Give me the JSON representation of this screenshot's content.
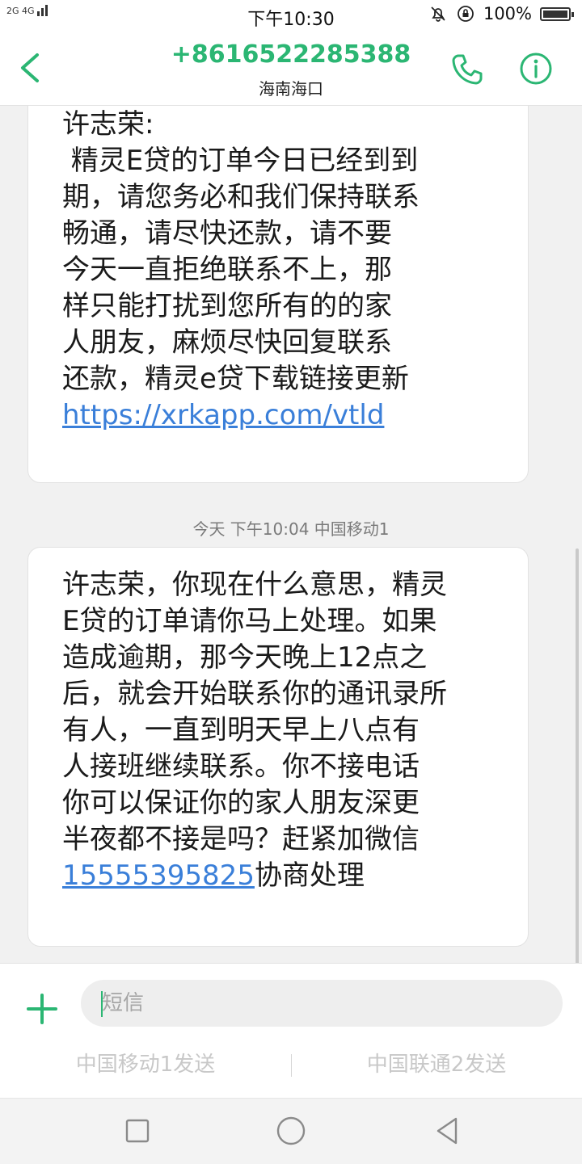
{
  "status_bar": {
    "left_indicators": "2G  4G",
    "time": "下午10:30",
    "battery_text": "100%",
    "battery_level": 1.0
  },
  "header": {
    "title": "+8616522285388",
    "subtitle": "海南海口",
    "icons": [
      "back-icon",
      "phone-icon",
      "info-icon"
    ],
    "accent_color": "#2bb673"
  },
  "messages": [
    {
      "lines": [
        "许志荣:",
        " 精灵E贷的订单今日已经到到",
        "期，请您务必和我们保持联系",
        "畅通，请尽快还款，请不要",
        "今天一直拒绝联系不上，那",
        "样只能打扰到您所有的的家",
        "人朋友，麻烦尽快回复联系",
        "还款，精灵e贷下载链接更新"
      ],
      "link": "https://xrkapp.com/vtld"
    },
    {
      "timestamp": "今天 下午10:04  中国移动1",
      "lines": [
        "许志荣，你现在什么意思，精灵",
        "E贷的订单请你马上处理。如果",
        "造成逾期，那今天晚上12点之",
        "后，就会开始联系你的通讯录所",
        "有人，一直到明天早上八点有",
        "人接班继续联系。你不接电话",
        "你可以保证你的家人朋友深更",
        "半夜都不接是吗？赶紧加微信"
      ],
      "link": "15555395825",
      "link_suffix": "协商处理"
    }
  ],
  "composer": {
    "placeholder": "短信",
    "value": "",
    "send_sim1": "中国移动1发送",
    "send_sim2": "中国联通2发送"
  },
  "nav": {
    "icons": [
      "recents-square-icon",
      "home-circle-icon",
      "back-triangle-icon"
    ]
  }
}
